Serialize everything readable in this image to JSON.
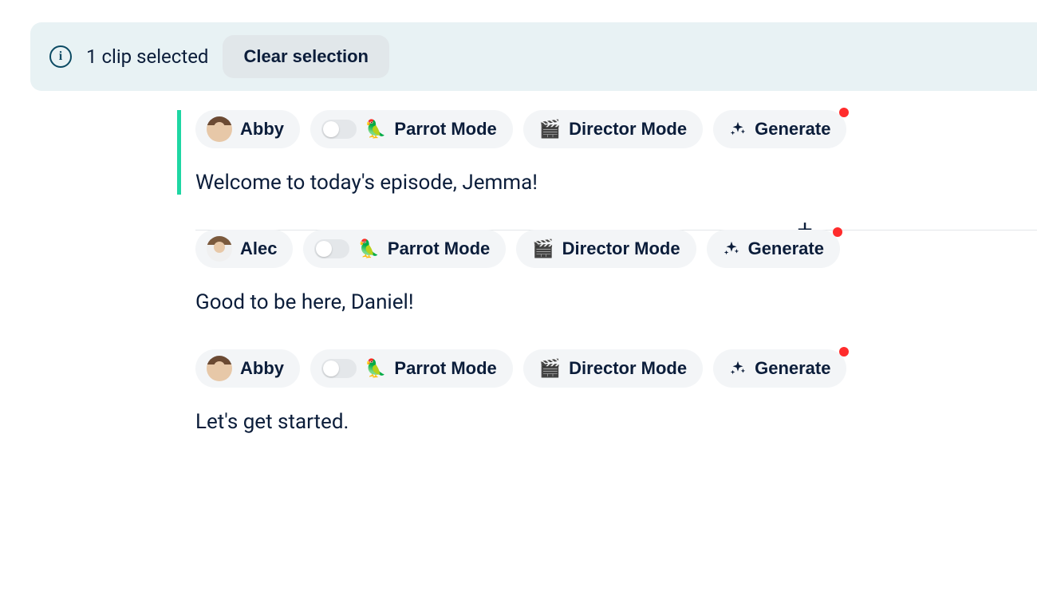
{
  "selection": {
    "text": "1 clip selected",
    "clear_label": "Clear selection"
  },
  "labels": {
    "parrot_mode": "Parrot Mode",
    "director_mode": "Director Mode",
    "generate": "Generate",
    "parrot_emoji": "🦜",
    "director_emoji": "🎬"
  },
  "clips": [
    {
      "speaker": "Abby",
      "avatar_kind": "female",
      "selected": true,
      "text": "Welcome to today's episode, Jemma!"
    },
    {
      "speaker": "Alec",
      "avatar_kind": "male",
      "selected": false,
      "text": "Good to be here, Daniel!"
    },
    {
      "speaker": "Abby",
      "avatar_kind": "female",
      "selected": false,
      "text": "Let's get started."
    }
  ]
}
